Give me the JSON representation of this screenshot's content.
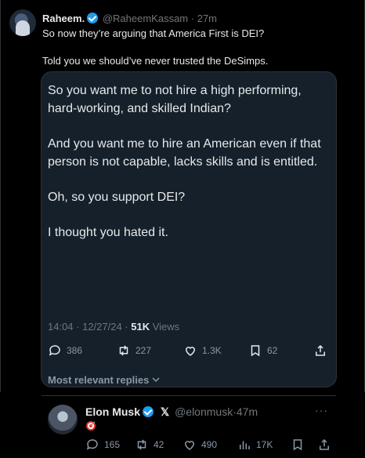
{
  "tweet": {
    "author_name": "Raheem.",
    "author_handle": "@RaheemKassam",
    "separator": "·",
    "time_ago": "27m",
    "text_line1": "So now they’re arguing that America First is DEI?",
    "text_line2": "Told you we should’ve never trusted the DeSimps."
  },
  "quote": {
    "para1": "So you want me to not hire a high performing, hard-working, and skilled Indian?",
    "para2": "And you want me to hire an American even if that person is not capable, lacks skills and is entitled.",
    "para3": "Oh, so you support DEI?",
    "para4": "I thought you hated it.",
    "timestamp": "14:04 · 12/27/24 · ",
    "views_count": "51K",
    "views_label": " Views",
    "actions": {
      "replies": "386",
      "reposts": "227",
      "likes": "1.3K",
      "bookmarks": "62"
    },
    "more_replies_label": "Most relevant replies"
  },
  "reply": {
    "author_name": "Elon Musk",
    "x_badge": "𝕏",
    "author_handle": "@elonmusk",
    "separator": "·",
    "time_ago": "47m",
    "actions": {
      "replies": "165",
      "reposts": "42",
      "likes": "490",
      "views": "17K"
    }
  },
  "colors": {
    "verified_blue": "#1d9bf0",
    "quote_bg": "#15202b",
    "background": "#000000"
  }
}
